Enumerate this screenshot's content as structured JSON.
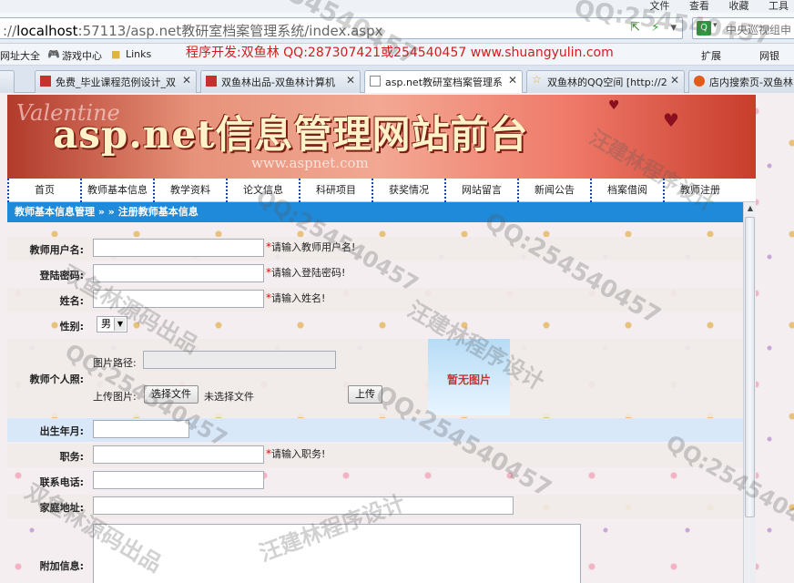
{
  "browser": {
    "top_menu": [
      "文件",
      "查看",
      "收藏",
      "工具"
    ],
    "url_prefix": "://",
    "url_host": "localhost",
    "url_rest": ":57113/asp.net教研室档案管理系统/index.aspx",
    "search_text": "中央巡视组申",
    "promo": "程序开发:双鱼林 QQ:287307421或254540457 www.shuangyulin.com",
    "favorites": [
      "网址大全",
      "游戏中心",
      "Links"
    ],
    "fav_right": [
      "扩展",
      "网银"
    ],
    "tabs": [
      {
        "label": "免费_毕业课程范例设计_双",
        "active": false
      },
      {
        "label": "双鱼林出品-双鱼林计算机",
        "active": false
      },
      {
        "label": "asp.net教研室档案管理系",
        "active": true
      },
      {
        "label": "双鱼林的QQ空间 [http://2",
        "active": false
      },
      {
        "label": "店内搜索页-双鱼林",
        "active": false
      }
    ]
  },
  "banner": {
    "title": "asp.net信息管理网站前台",
    "url": "www.aspnet.com",
    "deco": "Valentine"
  },
  "nav": [
    "首页",
    "教师基本信息",
    "教学资料",
    "论文信息",
    "科研项目",
    "获奖情况",
    "网站留言",
    "新闻公告",
    "档案借阅",
    "教师注册"
  ],
  "breadcrumb": "教师基本信息管理 » » 注册教师基本信息",
  "form": {
    "username": {
      "label": "教师用户名:",
      "hint": "请输入教师用户名!"
    },
    "password": {
      "label": "登陆密码:",
      "hint": "请输入登陆密码!"
    },
    "name": {
      "label": "姓名:",
      "hint": "请输入姓名!"
    },
    "gender": {
      "label": "性别:",
      "value": "男"
    },
    "photo": {
      "label": "教师个人照:",
      "path_label": "图片路径:",
      "upload_label": "上传图片:",
      "choose_button": "选择文件",
      "no_file": "未选择文件",
      "upload_button": "上传",
      "placeholder": "暂无图片"
    },
    "birthday": {
      "label": "出生年月:"
    },
    "position": {
      "label": "职务:",
      "hint": "请输入职务!"
    },
    "phone": {
      "label": "联系电话:"
    },
    "address": {
      "label": "家庭地址:"
    },
    "extra": {
      "label": "附加信息:"
    }
  },
  "watermark": {
    "qq": "QQ:254540457",
    "maker": "双鱼林源码出品",
    "designer": "汪建林程序设计"
  },
  "colors": {
    "accent": "#1e8ad9",
    "required": "#e00000",
    "promo": "#d21d1d"
  }
}
